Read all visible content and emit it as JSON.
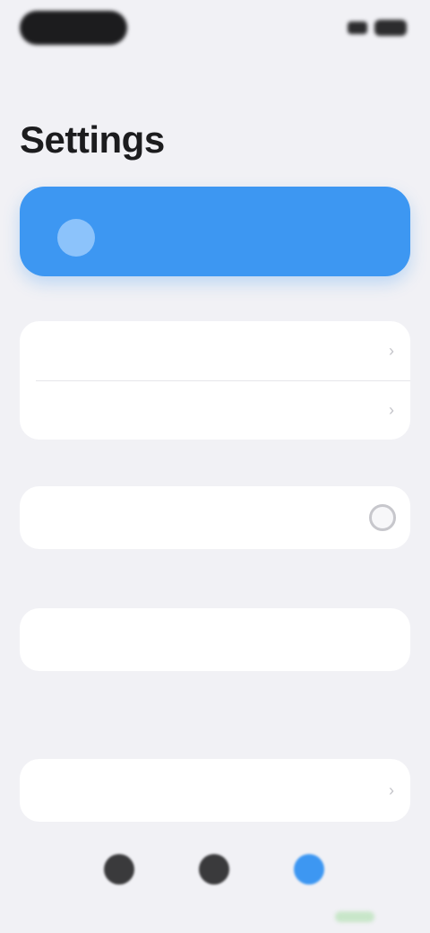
{
  "status_bar": {
    "time": "",
    "icons": [
      "signal-icon",
      "battery-icon"
    ]
  },
  "page": {
    "title": "Settings"
  },
  "hero": {
    "icon": "circle-icon",
    "text": "",
    "color": "#3d97f2"
  },
  "sections": [
    {
      "label": "",
      "rows": [
        {
          "label": "",
          "value": ""
        },
        {
          "label": "",
          "value": ""
        }
      ]
    },
    {
      "label": "",
      "rows": [
        {
          "label": ""
        }
      ],
      "footnote": ""
    },
    {
      "label": "",
      "rows": [
        {
          "label": ""
        }
      ],
      "footnote": ""
    },
    {
      "label": "",
      "rows": [
        {
          "label": "",
          "value": ""
        }
      ]
    }
  ],
  "tabs": [
    {
      "label": "",
      "icon": "home-icon",
      "active": false
    },
    {
      "label": "",
      "icon": "profile-icon",
      "active": false
    },
    {
      "label": "",
      "icon": "settings-icon",
      "active": true
    }
  ],
  "colors": {
    "accent": "#3d97f2",
    "background": "#f1f1f5"
  }
}
